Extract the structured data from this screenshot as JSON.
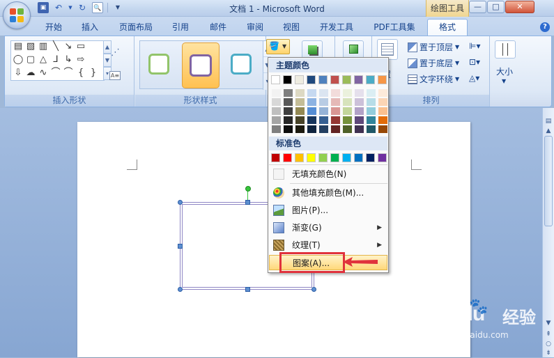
{
  "window": {
    "title": "文档 1 - Microsoft Word",
    "context_tab": "绘图工具",
    "min_label": "—",
    "max_label": "□",
    "close_label": "✕"
  },
  "qat": {
    "icons": [
      "save-icon",
      "undo-icon",
      "redo-icon",
      "print-preview-icon",
      "customize-icon"
    ]
  },
  "tabs": [
    {
      "label": "开始"
    },
    {
      "label": "插入"
    },
    {
      "label": "页面布局"
    },
    {
      "label": "引用"
    },
    {
      "label": "邮件"
    },
    {
      "label": "审阅"
    },
    {
      "label": "视图"
    },
    {
      "label": "开发工具"
    },
    {
      "label": "PDF工具集"
    },
    {
      "label": "格式",
      "active": true
    }
  ],
  "ribbon": {
    "groups": {
      "insert_shapes": "插入形状",
      "shape_styles": "形状样式",
      "arrange": "排列",
      "size": "大小"
    },
    "arrange": {
      "bring_front": "置于顶层",
      "send_back": "置于底层",
      "text_wrap": "文字环绕",
      "position_partial": "置"
    },
    "style_colors": [
      "#92c46a",
      "#8064a2",
      "#4bacc6"
    ]
  },
  "menu": {
    "theme_header": "主题颜色",
    "standard_header": "标准色",
    "theme_top_row": [
      "#ffffff",
      "#000000",
      "#eeece1",
      "#1f497d",
      "#4f81bd",
      "#c0504d",
      "#9bbb59",
      "#8064a2",
      "#4bacc6",
      "#f79646"
    ],
    "theme_shades": [
      [
        "#f2f2f2",
        "#7f7f7f",
        "#ddd9c3",
        "#c6d9f0",
        "#dbe5f1",
        "#f2dcdb",
        "#ebf1dd",
        "#e5e0ec",
        "#dbeef3",
        "#fdeada"
      ],
      [
        "#d8d8d8",
        "#595959",
        "#c4bd97",
        "#8db3e2",
        "#b8cce4",
        "#e5b9b7",
        "#d7e3bc",
        "#ccc1d9",
        "#b7dde8",
        "#fbd5b5"
      ],
      [
        "#bfbfbf",
        "#3f3f3f",
        "#938953",
        "#548dd4",
        "#95b3d7",
        "#d99694",
        "#c3d69b",
        "#b2a2c7",
        "#92cddc",
        "#fac08f"
      ],
      [
        "#a5a5a5",
        "#262626",
        "#494429",
        "#17365d",
        "#366092",
        "#953734",
        "#76923c",
        "#5f497a",
        "#31859b",
        "#e36c09"
      ],
      [
        "#7f7f7f",
        "#0c0c0c",
        "#1d1b10",
        "#0f243e",
        "#244061",
        "#632423",
        "#4f6128",
        "#3f3151",
        "#205867",
        "#974806"
      ]
    ],
    "standard": [
      "#c00000",
      "#ff0000",
      "#ffc000",
      "#ffff00",
      "#92d050",
      "#00b050",
      "#00b0f0",
      "#0070c0",
      "#002060",
      "#7030a0"
    ],
    "items": [
      {
        "label": "无填充颜色(N)",
        "icon": "no-fill-icon",
        "submenu": false
      },
      {
        "label": "其他填充颜色(M)...",
        "icon": "palette-icon",
        "submenu": false
      },
      {
        "label": "图片(P)...",
        "icon": "picture-icon",
        "submenu": false
      },
      {
        "label": "渐变(G)",
        "icon": "gradient-icon",
        "submenu": true
      },
      {
        "label": "纹理(T)",
        "icon": "texture-icon",
        "submenu": true
      },
      {
        "label": "图案(A)...",
        "icon": "pattern-icon",
        "submenu": false,
        "highlighted": true
      }
    ]
  },
  "colors": {
    "annotation": "#e0323c",
    "handle": "#5d8fd0",
    "rotate_handle": "#37c53c",
    "shape_outline": "#8e86c4"
  },
  "watermark": {
    "brand": "Baidu",
    "cn": "经验",
    "url": "jingyan.baidu.com"
  }
}
